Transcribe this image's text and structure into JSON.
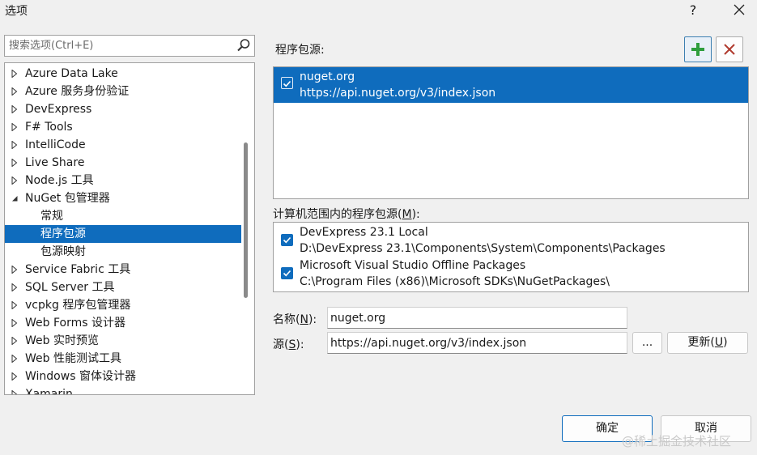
{
  "window": {
    "title": "选项",
    "help_label": "?"
  },
  "search": {
    "placeholder": "搜索选项(Ctrl+E)"
  },
  "tree": {
    "items": [
      {
        "label": "Azure Data Lake",
        "level": 0,
        "state": "collapsed"
      },
      {
        "label": "Azure 服务身份验证",
        "level": 0,
        "state": "collapsed"
      },
      {
        "label": "DevExpress",
        "level": 0,
        "state": "collapsed"
      },
      {
        "label": "F# Tools",
        "level": 0,
        "state": "collapsed"
      },
      {
        "label": "IntelliCode",
        "level": 0,
        "state": "collapsed"
      },
      {
        "label": "Live Share",
        "level": 0,
        "state": "collapsed"
      },
      {
        "label": "Node.js 工具",
        "level": 0,
        "state": "collapsed"
      },
      {
        "label": "NuGet 包管理器",
        "level": 0,
        "state": "expanded"
      },
      {
        "label": "常规",
        "level": 1,
        "state": "leaf"
      },
      {
        "label": "程序包源",
        "level": 1,
        "state": "leaf",
        "selected": true
      },
      {
        "label": "包源映射",
        "level": 1,
        "state": "leaf"
      },
      {
        "label": "Service Fabric 工具",
        "level": 0,
        "state": "collapsed"
      },
      {
        "label": "SQL Server 工具",
        "level": 0,
        "state": "collapsed"
      },
      {
        "label": "vcpkg 程序包管理器",
        "level": 0,
        "state": "collapsed"
      },
      {
        "label": "Web Forms 设计器",
        "level": 0,
        "state": "collapsed"
      },
      {
        "label": "Web 实时预览",
        "level": 0,
        "state": "collapsed"
      },
      {
        "label": "Web 性能测试工具",
        "level": 0,
        "state": "collapsed"
      },
      {
        "label": "Windows 窗体设计器",
        "level": 0,
        "state": "collapsed"
      },
      {
        "label": "Xamarin",
        "level": 0,
        "state": "collapsed"
      }
    ]
  },
  "package_sources": {
    "label": "程序包源:",
    "items": [
      {
        "name": "nuget.org",
        "url": "https://api.nuget.org/v3/index.json",
        "checked": true,
        "selected": true
      }
    ]
  },
  "machine_sources": {
    "label_prefix": "计算机范围内的程序包源(",
    "label_key": "M",
    "label_suffix": "):",
    "items": [
      {
        "name": "DevExpress 23.1 Local",
        "url": "D:\\DevExpress 23.1\\Components\\System\\Components\\Packages",
        "checked": true
      },
      {
        "name": "Microsoft Visual Studio Offline Packages",
        "url": "C:\\Program Files (x86)\\Microsoft SDKs\\NuGetPackages\\",
        "checked": true
      }
    ]
  },
  "form": {
    "name_label_prefix": "名称(",
    "name_label_key": "N",
    "name_label_suffix": "):",
    "name_value": "nuget.org",
    "source_label_prefix": "源(",
    "source_label_key": "S",
    "source_label_suffix": "):",
    "source_value": "https://api.nuget.org/v3/index.json",
    "browse_label": "...",
    "update_label_prefix": "更新(",
    "update_label_key": "U",
    "update_label_suffix": ")"
  },
  "footer": {
    "ok_label": "确定",
    "cancel_label": "取消"
  },
  "watermark": "@稀土掘金技术社区",
  "colors": {
    "selection": "#0f6cbd",
    "add_icon": "#2e9e3e",
    "remove_icon": "#b03a2e"
  }
}
